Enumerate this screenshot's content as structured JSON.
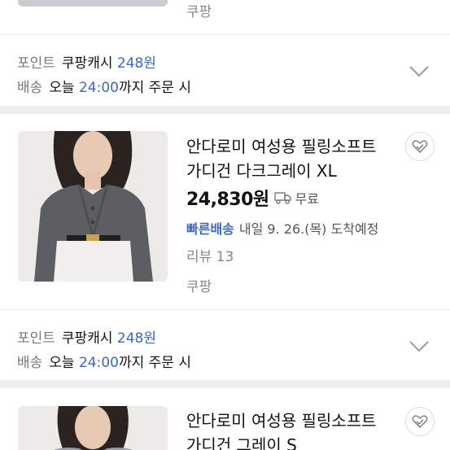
{
  "top_partial": {
    "seller": "쿠팡"
  },
  "info": {
    "point_label": "포인트",
    "coupang_cash_label": "쿠팡캐시",
    "coupang_cash_amount": "248원",
    "shipping_label": "배송",
    "today_label": "오늘",
    "time": "24:00",
    "order_suffix": "까지 주문 시"
  },
  "products": [
    {
      "title_line1": "안다로미 여성용 필링소프트",
      "title_line2": "가디건 다크그레이 XL",
      "price": "24,830원",
      "shipping": "무료",
      "delivery_badge": "빠른배송",
      "delivery_date": "내일 9. 26.(목) 도착예정",
      "review": "리뷰 13",
      "seller": "쿠팡",
      "colors": {
        "sweater": "#5b5e63",
        "pants": "#f2f0ec",
        "bg": "#ecebe8"
      }
    },
    {
      "title_line1": "안다로미 여성용 필링소프트",
      "title_line2": "가디건 그레이 S",
      "colors": {
        "sweater": "#9c9ea2",
        "bg": "#ecebe8"
      }
    }
  ],
  "accent_color": "#3f68b5"
}
